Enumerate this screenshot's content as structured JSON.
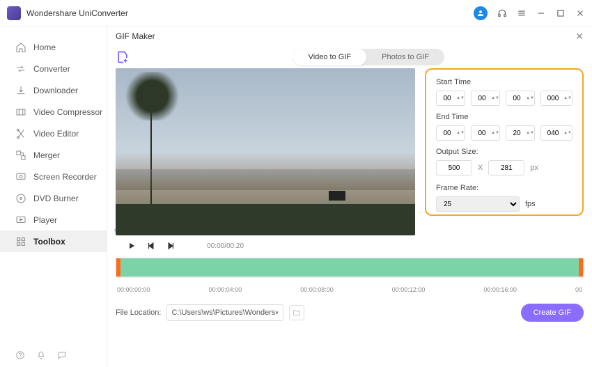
{
  "app_title": "Wondershare UniConverter",
  "sidebar": {
    "items": [
      {
        "label": "Home"
      },
      {
        "label": "Converter"
      },
      {
        "label": "Downloader"
      },
      {
        "label": "Video Compressor"
      },
      {
        "label": "Video Editor"
      },
      {
        "label": "Merger"
      },
      {
        "label": "Screen Recorder"
      },
      {
        "label": "DVD Burner"
      },
      {
        "label": "Player"
      },
      {
        "label": "Toolbox"
      }
    ]
  },
  "panel": {
    "title": "GIF Maker",
    "tabs": [
      {
        "label": "Video to GIF"
      },
      {
        "label": "Photos to GIF"
      }
    ],
    "time_display": "00:00/00:20",
    "settings": {
      "start_time_label": "Start Time",
      "end_time_label": "End Time",
      "start_time": [
        "00",
        "00",
        "00",
        "000"
      ],
      "end_time": [
        "00",
        "00",
        "20",
        "040"
      ],
      "output_size_label": "Output Size:",
      "output_size": {
        "w": "500",
        "h": "281"
      },
      "size_sep": "X",
      "px_unit": "px",
      "frame_rate_label": "Frame Rate:",
      "frame_rate": "25",
      "fps_unit": "fps"
    },
    "timeline_ticks": [
      "00:00:00:00",
      "00:00:04:00",
      "00:00:08:00",
      "00:00:12:00",
      "00:00:16:00",
      "00"
    ],
    "file_location_label": "File Location:",
    "file_location_path": "C:\\Users\\ws\\Pictures\\Wonders",
    "create_btn": "Create GIF"
  }
}
